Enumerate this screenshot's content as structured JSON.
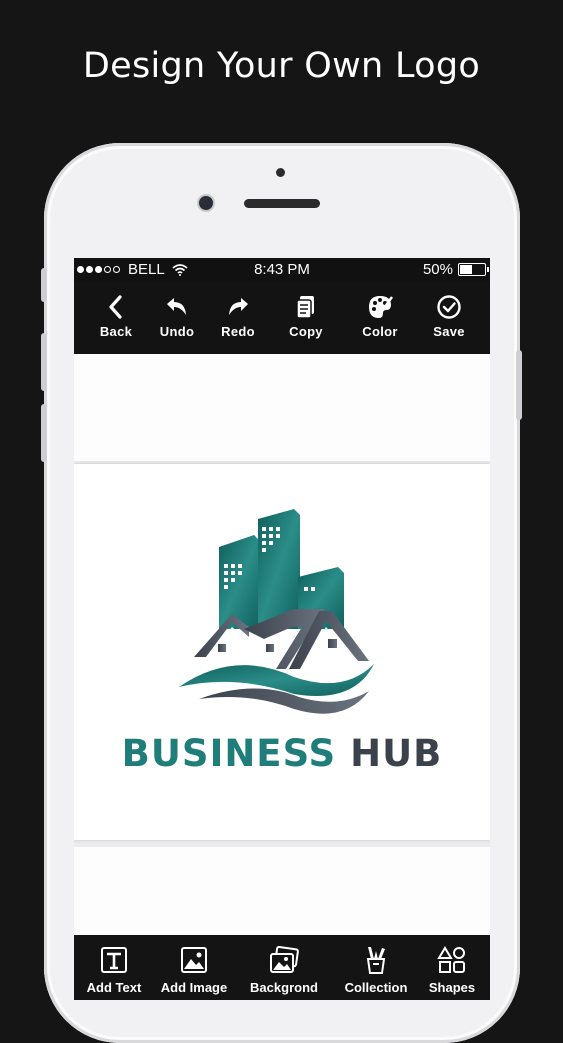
{
  "promo": {
    "headline": "Design Your Own Logo"
  },
  "status_bar": {
    "carrier": "BELL",
    "time": "8:43 PM",
    "battery": "50%"
  },
  "toolbar": {
    "back": "Back",
    "undo": "Undo",
    "redo": "Redo",
    "copy": "Copy",
    "color": "Color",
    "save": "Save"
  },
  "logo": {
    "word1": "BUSINESS",
    "word2": "HUB"
  },
  "bottom_bar": {
    "add_text": "Add Text",
    "add_image": "Add Image",
    "background": "Backgrond",
    "collection": "Collection",
    "shapes": "Shapes"
  },
  "colors": {
    "teal": "#1f7e7a",
    "slate": "#3c424c",
    "bar": "#131313"
  }
}
